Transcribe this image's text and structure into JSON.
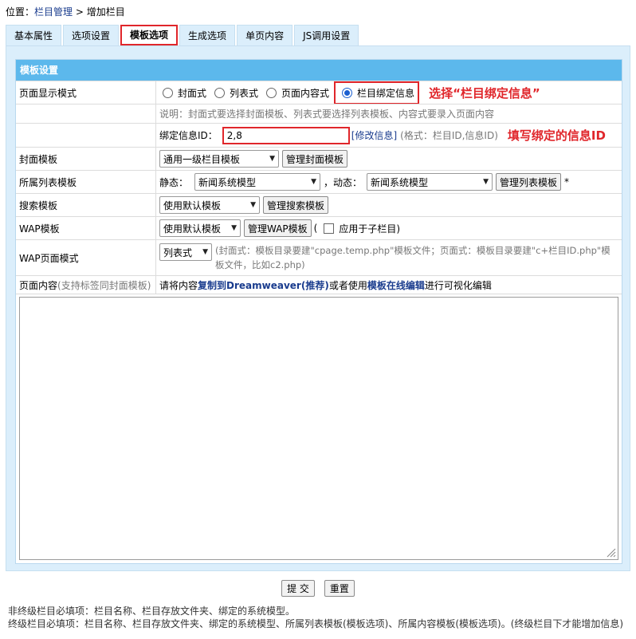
{
  "breadcrumb": {
    "prefix": "位置：",
    "link": "栏目管理",
    "sep": " > ",
    "current": "增加栏目"
  },
  "tabs": [
    "基本属性",
    "选项设置",
    "模板选项",
    "生成选项",
    "单页内容",
    "JS调用设置"
  ],
  "active_tab": "模板选项",
  "section_title": "模板设置",
  "display_mode": {
    "label": "页面显示模式",
    "options": [
      "封面式",
      "列表式",
      "页面内容式",
      "栏目绑定信息"
    ],
    "selected": "栏目绑定信息",
    "annotation": "选择“栏目绑定信息”"
  },
  "note": "说明：封面式要选择封面模板、列表式要选择列表模板、内容式要录入页面内容",
  "bind_info": {
    "label": "绑定信息ID：",
    "value": "2,8",
    "modify_link": "[修改信息]",
    "hint": "(格式：栏目ID,信息ID)",
    "annotation": "填写绑定的信息ID"
  },
  "cover_template": {
    "label": "封面模板",
    "selected": "通用一级栏目模板",
    "button": "管理封面模板"
  },
  "list_template": {
    "label": "所属列表模板",
    "static_label": "静态：",
    "static_selected": "新闻系统模型",
    "dynamic_label": "，动态：",
    "dynamic_selected": "新闻系统模型",
    "button": "管理列表模板",
    "required_mark": "*"
  },
  "search_template": {
    "label": "搜索模板",
    "selected": "使用默认模板",
    "button": "管理搜索模板"
  },
  "wap_template": {
    "label": "WAP模板",
    "selected": "使用默认模板",
    "button": "管理WAP模板",
    "paren_open": "(",
    "checkbox_label": "应用于子栏目)"
  },
  "wap_page_mode": {
    "label": "WAP页面模式",
    "selected": "列表式",
    "desc_line1": "(封面式：模板目录要建\"cpage.temp.php\"模板文件；页面式：模板目录要建\"c+栏目ID.php\"模",
    "desc_line2": "板文件，比如c2.php)"
  },
  "page_content": {
    "label": "页面内容",
    "label_note": "(支持标签同封面模板)",
    "text1": "请将内容",
    "link1": "复制到Dreamweaver(推荐)",
    "text2": "或者使用",
    "link2": "模板在线编辑",
    "text3": "进行可视化编辑"
  },
  "buttons": {
    "submit": "提 交",
    "reset": "重置"
  },
  "footer_notes": [
    "非终级栏目必填项：栏目名称、栏目存放文件夹、绑定的系统模型。",
    "终级栏目必填项：栏目名称、栏目存放文件夹、绑定的系统模型、所属列表模板(模板选项)、所属内容模板(模板选项)。(终级栏目下才能增加信息)"
  ],
  "colors": {
    "header": "#5cb8ec",
    "panel": "#dbeefb",
    "highlight": "#e0262b",
    "link": "#1a3c8e"
  }
}
